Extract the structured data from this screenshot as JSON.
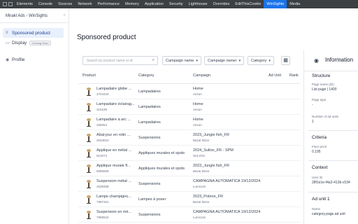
{
  "devtools": {
    "tabs": [
      "Elements",
      "Console",
      "Sources",
      "Network",
      "Performance",
      "Memory",
      "Application",
      "Security",
      "Lighthouse",
      "Overrides",
      "EditThisCookie",
      "WinSights",
      "Media"
    ],
    "active_tab": "WinSights"
  },
  "sidebar": {
    "brand": "Mirakl Ads - WinSights",
    "items": [
      {
        "label": "Sponsored product",
        "icon": "list-icon",
        "active": true
      },
      {
        "label": "Display",
        "icon": "display-icon",
        "badge": "Coming Soon"
      },
      {
        "label": "Profile",
        "icon": "profile-icon"
      }
    ]
  },
  "main": {
    "title": "Sponsored product",
    "search_placeholder": "Search by product name or id",
    "filters": [
      "Campaign name",
      "Campaign owner",
      "Category"
    ],
    "columns": [
      "Product",
      "Category",
      "Campaign",
      "Ad Unit",
      "Rank"
    ],
    "rows": [
      {
        "name": "Lampadaire globe ...",
        "id": "2704420",
        "category": "Lampadaires",
        "campaign": "Home",
        "owner": "Aeson"
      },
      {
        "name": "Lampadaire éclairag...",
        "id": "310199",
        "category": "Lampadaires",
        "campaign": "Home",
        "owner": "Aeson"
      },
      {
        "name": "Lampadaire à arc ...",
        "id": "256064",
        "category": "Lampadaires",
        "campaign": "Home",
        "owner": "Aeson"
      },
      {
        "name": "Abat-jour en rotin ...",
        "id": "2533024",
        "category": "Suspensions",
        "campaign": "2023_Jungle fish_FR",
        "owner": "Bazar Bizar"
      },
      {
        "name": "Applique en métal ...",
        "id": "813074",
        "category": "Appliques murales et spots",
        "campaign": "2024_Sullon_FR - SPM",
        "owner": "SULION"
      },
      {
        "name": "Applique murale fl...",
        "id": "9095559",
        "category": "Appliques murales et spots",
        "campaign": "2023_Jungle fish_FR",
        "owner": "Bazar Bizar"
      },
      {
        "name": "Suspension métal ...",
        "id": "2539488",
        "category": "Suspensions",
        "campaign": "CAMPAGNA AUTOMATICA 19/12/2024",
        "owner": "Lumicom"
      },
      {
        "name": "Lampe champigno...",
        "id": "7997461",
        "category": "Lampes à poser",
        "campaign": "2023_Potiron_FR",
        "owner": "Bazar Bizar"
      },
      {
        "name": "Suspension en mé...",
        "id": "7995534",
        "category": "Suspensions",
        "campaign": "CAMPAGNA AUTOMATICA 19/12/2024",
        "owner": "Lumicom"
      }
    ]
  },
  "info": {
    "title": "Information",
    "structure": "Structure",
    "page_name_label": "Page name (ID)",
    "page_name_value": "List page | 1400",
    "page_type_label": "Page type",
    "page_type_value": "-",
    "ad_units_label": "Number of ad units",
    "ad_units_value": "1",
    "criteria": "Criteria",
    "floor_price_label": "Floor price",
    "floor_price_value": "0.195",
    "context": "Context",
    "user_id_label": "User ID",
    "user_id_value": "28f1e1e-f4a2-412b-c534",
    "ad_unit": "Ad unit 1",
    "name_label": "Name",
    "name_value": "category.page.ad unit"
  },
  "colors": {
    "accent": "#1a73e8",
    "active_nav_bg": "#e8f0fe",
    "devtools_bg": "#3c4043"
  }
}
